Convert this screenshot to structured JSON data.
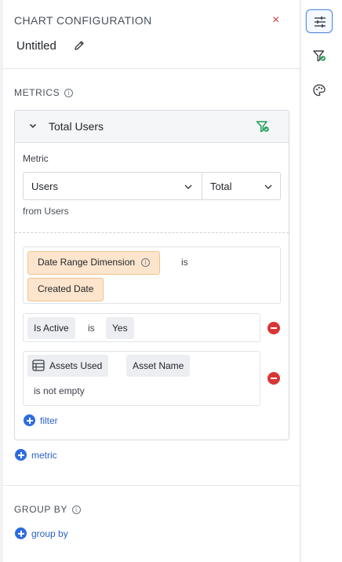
{
  "header": {
    "title": "CHART CONFIGURATION",
    "close_symbol": "×",
    "chart_name": "Untitled"
  },
  "metrics_section": {
    "label": "METRICS",
    "info_symbol": "i",
    "card": {
      "title": "Total Users",
      "metric_label": "Metric",
      "metric_value": "Users",
      "aggregation_value": "Total",
      "source_text": "from Users",
      "filters": [
        {
          "field": "Date Range Dimension",
          "info_symbol": "i",
          "operator": "is",
          "value": "Created Date"
        },
        {
          "field": "Is Active",
          "operator": "is",
          "value": "Yes"
        },
        {
          "table": "Assets Used",
          "field": "Asset Name",
          "operator": "is not empty"
        }
      ],
      "add_filter_label": "filter"
    },
    "add_metric_label": "metric"
  },
  "group_by_section": {
    "label": "GROUP BY",
    "info_symbol": "i",
    "add_group_by_label": "group by"
  },
  "rail": {
    "icons": [
      "sliders-icon",
      "filter-icon",
      "palette-icon"
    ],
    "active": "sliders-icon"
  },
  "colors": {
    "accent": "#2d6be0",
    "remove": "#d93636",
    "chip_orange": "#fce5cc",
    "filter_green": "#1f9e57"
  }
}
